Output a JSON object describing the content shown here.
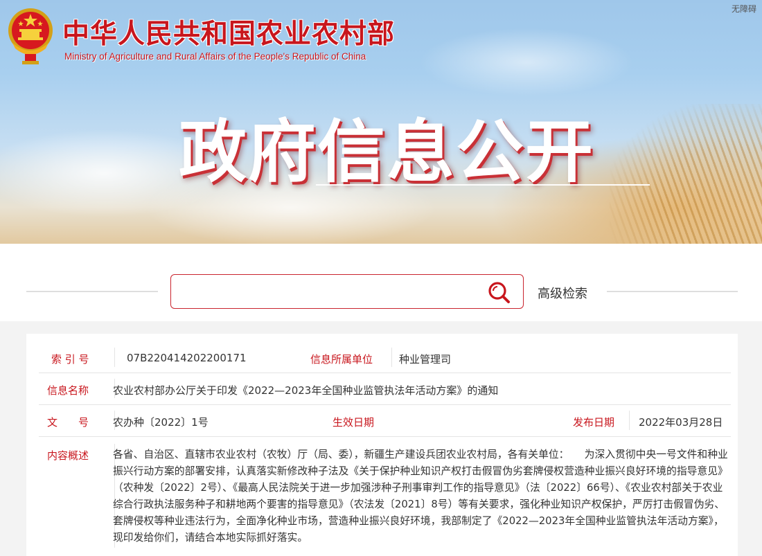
{
  "header": {
    "org_name_cn": "中华人民共和国农业农村部",
    "org_name_en": "Ministry of Agriculture and Rural Affairs of the People's Republic of China",
    "accessibility_link": "无障碍",
    "banner_title": "政府信息公开"
  },
  "search": {
    "placeholder": "",
    "value": "",
    "advanced_label": "高级检索"
  },
  "info": {
    "index_label": "索 引 号",
    "index_value": "07B220414202200171",
    "unit_label": "信息所属单位",
    "unit_value": "种业管理司",
    "name_label": "信息名称",
    "name_value": "农业农村部办公厅关于印发《2022—2023年全国种业监管执法年活动方案》的通知",
    "doc_label": "文　　号",
    "doc_value": "农办种〔2022〕1号",
    "effective_label": "生效日期",
    "effective_value": "",
    "publish_label": "发布日期",
    "publish_value": "2022年03月28日",
    "summary_label": "内容概述",
    "summary_value": "各省、自治区、直辖市农业农村（农牧）厅（局、委），新疆生产建设兵团农业农村局，各有关单位：　　为深入贯彻中央一号文件和种业振兴行动方案的部署安排，认真落实新修改种子法及《关于保护种业知识产权打击假冒伪劣套牌侵权营造种业振兴良好环境的指导意见》（农种发〔2022〕2号）、《最高人民法院关于进一步加强涉种子刑事审判工作的指导意见》（法〔2022〕66号）、《农业农村部关于农业综合行政执法服务种子和耕地两个要害的指导意见》（农法发〔2021〕8号）等有关要求，强化种业知识产权保护，严厉打击假冒伪劣、套牌侵权等种业违法行为，全面净化种业市场，营造种业振兴良好环境，我部制定了《2022—2023年全国种业监管执法年活动方案》，现印发给你们，请结合本地实际抓好落实。"
  },
  "colors": {
    "accent_red": "#c8161d",
    "text": "#333333",
    "divider": "#e4e4e4"
  }
}
